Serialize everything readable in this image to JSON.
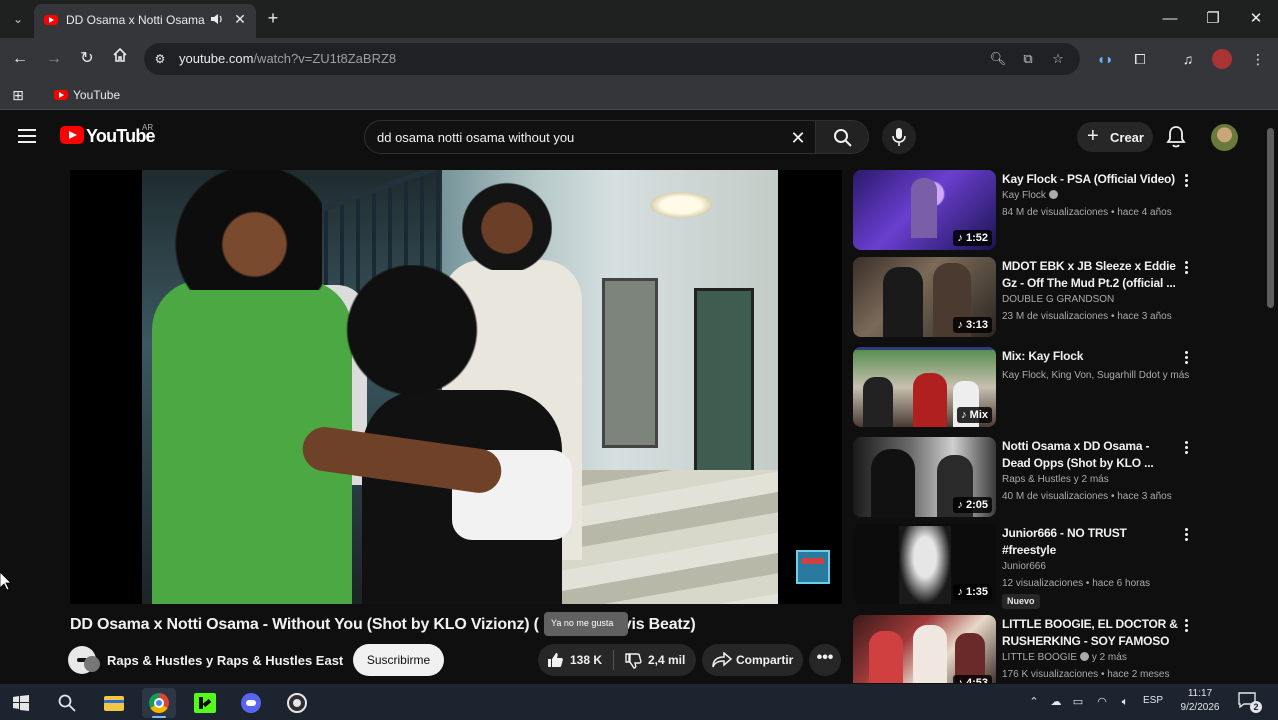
{
  "browser": {
    "tab": {
      "title": "DD Osama x Notti Osama -",
      "audio_icon": "speaker-icon",
      "close_icon": "close-icon"
    },
    "new_tab_icon": "plus-icon",
    "window_controls": {
      "minimize": "—",
      "restore": "❐",
      "close": "✕"
    },
    "url": {
      "host": "youtube.com",
      "path": "/watch?v=ZU1t8ZaBRZ8"
    },
    "bookmarks": [
      {
        "label": "YouTube"
      }
    ]
  },
  "youtube": {
    "logo_text": "YouTube",
    "country_code": "AR",
    "search": {
      "query": "dd osama notti osama without you"
    },
    "create_label": "Crear"
  },
  "video": {
    "title": "DD Osama x Notti Osama - Without You (Shot by KLO Vizionz) (",
    "title_tail": "vis Beatz)",
    "tooltip": "Ya no me gusta",
    "channel": "Raps & Hustles y Raps & Hustles East",
    "subscribe_label": "Suscribirme",
    "likes": "138 K",
    "dislikes": "2,4 mil",
    "share_label": "Compartir",
    "more_label": "•••"
  },
  "recommendations": [
    {
      "title": "Kay Flock - PSA (Official Video)",
      "channel": "Kay Flock",
      "verified": true,
      "meta": "84 M de visualizaciones • hace 4 años",
      "duration": "♪ 1:52"
    },
    {
      "title": "MDOT EBK x JB Sleeze x Eddie Gz - Off The Mud Pt.2 (official ...",
      "channel": "DOUBLE G GRANDSON",
      "meta": "23 M de visualizaciones • hace 3 años",
      "duration": "♪ 3:13"
    },
    {
      "title": "Mix: Kay Flock",
      "channel": "Kay Flock, King Von, Sugarhill Ddot y más",
      "meta": "",
      "duration": "♪ Mix"
    },
    {
      "title": "Notti Osama x DD Osama - Dead Opps (Shot by KLO ...",
      "channel": "Raps & Hustles y 2 más",
      "meta": "40 M de visualizaciones • hace 3 años",
      "duration": "♪ 2:05"
    },
    {
      "title": "Junior666 - NO TRUST #freestyle",
      "channel": "Junior666",
      "meta": "12 visualizaciones • hace 6 horas",
      "duration": "♪ 1:35",
      "badge": "Nuevo"
    },
    {
      "title": "LITTLE BOOGIE, EL DOCTOR & RUSHERKING - SOY FAMOSO ...",
      "channel": "LITTLE BOOGIE",
      "channel_suffix": "y 2 más",
      "verified": true,
      "meta": "176 K visualizaciones • hace 2 meses",
      "duration": "♪ 4:53"
    }
  ],
  "taskbar": {
    "language": "ESP",
    "time": "11:17",
    "date": "9/2/2026",
    "notification_count": "2"
  }
}
